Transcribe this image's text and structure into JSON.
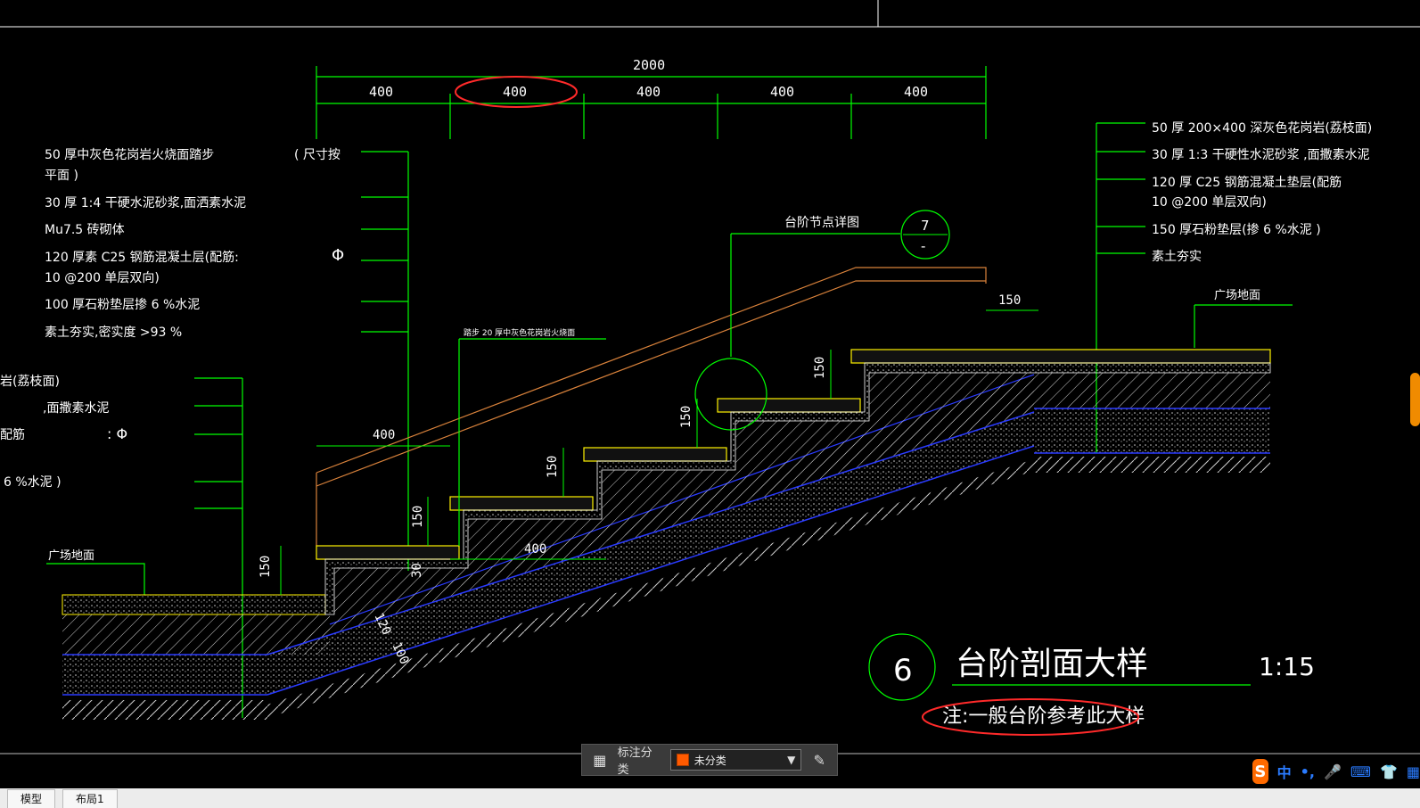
{
  "cad": {
    "dimensions": {
      "overall": "2000",
      "segments": [
        "400",
        "400",
        "400",
        "400",
        "400"
      ],
      "right_top": "150",
      "left_run": "400",
      "mid_run": "400",
      "heights": [
        "150",
        "150",
        "150",
        "150",
        "150"
      ],
      "thickness_30": "30",
      "slab_120": "120",
      "slab_100": "100"
    },
    "left_notes": [
      "50 厚中灰色花岗岩火烧面踏步",
      "平面  )",
      "30 厚 1:4  干硬水泥砂浆,面洒素水泥",
      "Mu7.5  砖砌体",
      "120  厚素   C25 钢筋混凝土层(配筋:",
      "10 @200  单层双向)",
      "100  厚石粉垫层掺          6 %水泥",
      "素土夯实,密实度            >93 %"
    ],
    "left_note_right": "( 尺寸按",
    "phi_1": "Φ",
    "right_notes": [
      "50 厚  200×400  深灰色花岗岩(荔枝面)",
      "30 厚  1:3   干硬性水泥砂浆                 ,面撒素水泥",
      "120  厚  C25 钢筋混凝土垫层(配筋",
      "10 @200  单层双向)",
      "150  厚石粉垫层(掺                6 %水泥    )",
      "素土夯实"
    ],
    "left_mid_notes": [
      "岩(荔枝面)",
      ",面撒素水泥",
      "配筋",
      "6 %水泥    )"
    ],
    "phi_2": ":  Φ",
    "plaza_left": "广场地面",
    "plaza_right": "广场地面",
    "detail_label": "台阶节点详图",
    "detail_ref_top": "7",
    "detail_ref_bottom": "-",
    "small_note": "踏步    20 厚中灰色花岗岩火烧面",
    "title_number": "6",
    "title": "台阶剖面大样",
    "scale": "1:15",
    "note": "注:一般台阶参考此大样"
  },
  "toolbar": {
    "label": "标注分类",
    "selected": "未分类"
  },
  "tabs": [
    "模型",
    "布局1"
  ],
  "ime": {
    "logo": "S",
    "items": [
      "中",
      "•,",
      "🎤",
      "⌨",
      "👕",
      "▦"
    ]
  },
  "colors": {
    "background": "#000000",
    "dim": "#00ff00",
    "leader": "#00ff00",
    "rail": "#d9823b",
    "hatch": "#ffffff",
    "blue": "#2a3bff",
    "yellow": "#fff200",
    "highlight": "#ff2a2a"
  }
}
